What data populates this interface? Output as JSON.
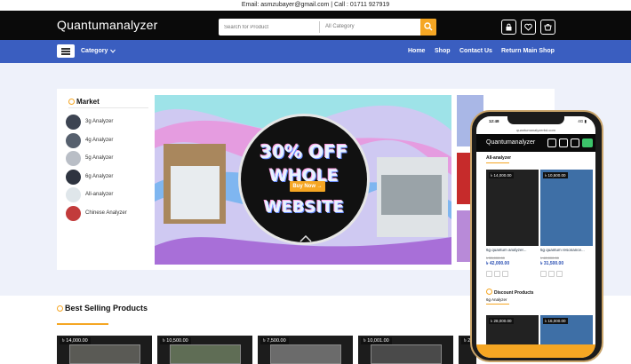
{
  "topbar": {
    "contact": "Email: asmzubayer@gmail.com | Call : 01711 927919"
  },
  "header": {
    "brand": "Quantumanalyzer",
    "search_placeholder": "Search for Product",
    "category_select": "All Category",
    "icons": [
      "lock-icon",
      "heart-icon",
      "cart-icon"
    ]
  },
  "nav": {
    "category_label": "Category",
    "links": [
      "Home",
      "Shop",
      "Contact Us",
      "Return Main Shop"
    ]
  },
  "sidebar": {
    "title": "Market",
    "items": [
      "3g Analyzer",
      "4g Analyzer",
      "5g Analyzer",
      "6g Analyzer",
      "All-analyzer",
      "Chinese Analyzer"
    ]
  },
  "banner": {
    "line1": "30% OFF",
    "line2": "WHOLE",
    "line3": "WEBSITE",
    "button": "Buy Now →"
  },
  "best_selling": {
    "title": "Best Selling Products",
    "prices": [
      "৳ 14,000.00",
      "৳ 10,500.00",
      "৳ 7,500.00",
      "৳ 10,001.00",
      "৳ 20"
    ]
  },
  "mobile": {
    "time": "12:48",
    "signal": "4G ▮",
    "url": "quantumanalyzerbd.com",
    "brand": "Quantumanalyzer",
    "section1": "All-analyzer",
    "products": [
      {
        "tag": "৳ 14,000.00",
        "name": "6g quantum analyzer...",
        "old": "৳ 55,000.00",
        "new": "৳ 42,000.00"
      },
      {
        "tag": "৳ 10,500.00",
        "name": "5g quantum resonance...",
        "old": "৳ 42,000.00",
        "new": "৳ 31,500.00"
      }
    ],
    "section2": "Discount Products",
    "section2_sub": "6g Analyzer",
    "products2": [
      "৳ 28,000.00",
      "৳ 16,000.00"
    ]
  },
  "colors": {
    "accent": "#f5a623",
    "nav_blue": "#3a5ec0",
    "header_black": "#0a0a0a",
    "page_bg": "#eef1fa"
  }
}
